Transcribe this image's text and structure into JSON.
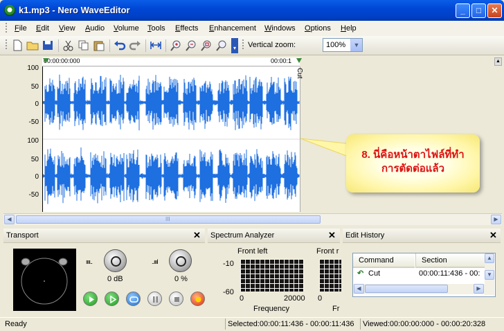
{
  "window": {
    "title": "k1.mp3 - Nero WaveEditor",
    "min": "_",
    "max": "□",
    "close": "✕"
  },
  "menu": [
    "File",
    "Edit",
    "View",
    "Audio",
    "Volume",
    "Tools",
    "Effects",
    "Enhancement",
    "Windows",
    "Options",
    "Help"
  ],
  "toolbar": {
    "vertical_zoom_label": "Vertical zoom:",
    "vertical_zoom_value": "100%"
  },
  "editor": {
    "ruler_start": "00:00:00:000",
    "ruler_marker": "00:00:1",
    "cut_label": "Cut",
    "y_ticks_top": [
      "100",
      "50",
      "0",
      "-50"
    ],
    "y_ticks_bottom": [
      "100",
      "50",
      "0",
      "-50"
    ],
    "scroll_thumb_mark": "III"
  },
  "callout": {
    "line1": "8. นี่คือหน้าตาไฟล์ที่ทำ",
    "line2": "การตัดต่อแล้ว"
  },
  "transport": {
    "title": "Transport",
    "volume_label": "0 dB",
    "pan_label": "0 %",
    "close": "✕"
  },
  "spectrum": {
    "title": "Spectrum Analyzer",
    "front_left": "Front left",
    "front_right": "Front r",
    "y_high": "-10",
    "y_low": "-60",
    "x_start": "0",
    "x_end": "20000",
    "x_start2": "0",
    "xlabel": "Frequency",
    "xlabel2": "Fr",
    "close": "✕"
  },
  "history": {
    "title": "Edit History",
    "col_command": "Command",
    "col_section": "Section",
    "rows": [
      {
        "command": "Cut",
        "section": "00:00:11:436 - 00:"
      }
    ],
    "close": "✕"
  },
  "status": {
    "ready": "Ready",
    "selected": "Selected:00:00:11:436 - 00:00:11:436",
    "viewed": "Viewed:00:00:00:000 - 00:00:20:328"
  },
  "colors": {
    "waveform": "#1e6fe0",
    "title_bar": "#0047d6",
    "callout_text": "#dd1111"
  }
}
